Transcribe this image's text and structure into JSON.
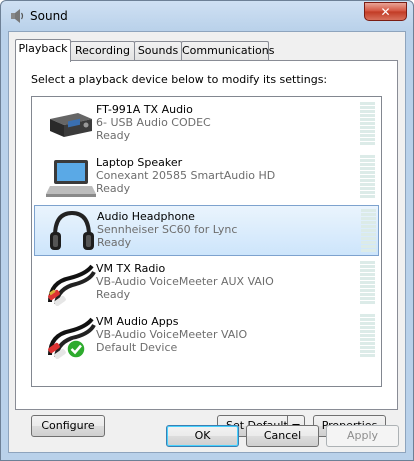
{
  "window": {
    "title": "Sound",
    "close_label": "✕"
  },
  "tabs": [
    {
      "label": "Playback",
      "active": true
    },
    {
      "label": "Recording",
      "active": false
    },
    {
      "label": "Sounds",
      "active": false
    },
    {
      "label": "Communications",
      "active": false
    }
  ],
  "panel": {
    "prompt": "Select a playback device below to modify its settings:"
  },
  "devices": [
    {
      "name": "FT-991A TX Audio",
      "description": "6- USB Audio CODEC",
      "status": "Ready",
      "icon": "usb-audio-device-icon",
      "selected": false
    },
    {
      "name": "Laptop Speaker",
      "description": "Conexant 20585 SmartAudio HD",
      "status": "Ready",
      "icon": "laptop-icon",
      "selected": false
    },
    {
      "name": "Audio Headphone",
      "description": "Sennheiser SC60 for Lync",
      "status": "Ready",
      "icon": "headphones-icon",
      "selected": true
    },
    {
      "name": "VM TX Radio",
      "description": "VB-Audio VoiceMeeter AUX VAIO",
      "status": "Ready",
      "icon": "rca-cable-icon",
      "selected": false
    },
    {
      "name": "VM Audio Apps",
      "description": "VB-Audio VoiceMeeter VAIO",
      "status": "Default Device",
      "icon": "rca-cable-default-icon",
      "selected": false
    }
  ],
  "panel_buttons": {
    "configure": "Configure",
    "set_default": "Set Default",
    "properties": "Properties"
  },
  "dialog_buttons": {
    "ok": "OK",
    "cancel": "Cancel",
    "apply": "Apply"
  },
  "colors": {
    "selection": "#cde5fb",
    "default_check": "#2eab2e",
    "meter": "#dcebe8"
  }
}
